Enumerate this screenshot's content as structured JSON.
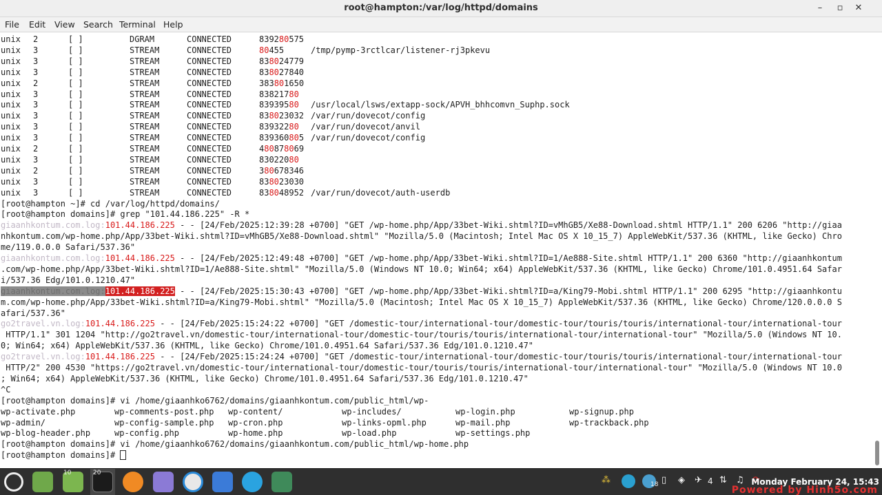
{
  "window": {
    "title": "root@hampton:/var/log/httpd/domains",
    "minimize": "–",
    "maximize": "▫",
    "close": "✕"
  },
  "menu": [
    "File",
    "Edit",
    "View",
    "Search",
    "Terminal",
    "Help"
  ],
  "sockets": [
    {
      "proto": "unix",
      "refcnt": "2",
      "flags": "[ ]",
      "type": "DGRAM",
      "state": "CONNECTED",
      "inode": [
        [
          "8392",
          ""
        ],
        [
          "80",
          "r"
        ],
        [
          "575",
          ""
        ]
      ],
      "path": ""
    },
    {
      "proto": "unix",
      "refcnt": "3",
      "flags": "[ ]",
      "type": "STREAM",
      "state": "CONNECTED",
      "inode": [
        [
          "80",
          "r"
        ],
        [
          "455",
          ""
        ]
      ],
      "path": "/tmp/pymp-3rctlcar/listener-rj3pkevu"
    },
    {
      "proto": "unix",
      "refcnt": "3",
      "flags": "[ ]",
      "type": "STREAM",
      "state": "CONNECTED",
      "inode": [
        [
          "83",
          ""
        ],
        [
          "80",
          "r"
        ],
        [
          "24779",
          ""
        ]
      ],
      "path": ""
    },
    {
      "proto": "unix",
      "refcnt": "3",
      "flags": "[ ]",
      "type": "STREAM",
      "state": "CONNECTED",
      "inode": [
        [
          "83",
          ""
        ],
        [
          "80",
          "r"
        ],
        [
          "27840",
          ""
        ]
      ],
      "path": ""
    },
    {
      "proto": "unix",
      "refcnt": "2",
      "flags": "[ ]",
      "type": "STREAM",
      "state": "CONNECTED",
      "inode": [
        [
          "383",
          ""
        ],
        [
          "80",
          "r"
        ],
        [
          "1650",
          ""
        ]
      ],
      "path": ""
    },
    {
      "proto": "unix",
      "refcnt": "3",
      "flags": "[ ]",
      "type": "STREAM",
      "state": "CONNECTED",
      "inode": [
        [
          "838217",
          ""
        ],
        [
          "80",
          "r"
        ]
      ],
      "path": ""
    },
    {
      "proto": "unix",
      "refcnt": "3",
      "flags": "[ ]",
      "type": "STREAM",
      "state": "CONNECTED",
      "inode": [
        [
          "839395",
          ""
        ],
        [
          "80",
          "r"
        ]
      ],
      "path": "/usr/local/lsws/extapp-sock/APVH_bhhcomvn_Suphp.sock"
    },
    {
      "proto": "unix",
      "refcnt": "3",
      "flags": "[ ]",
      "type": "STREAM",
      "state": "CONNECTED",
      "inode": [
        [
          "83",
          ""
        ],
        [
          "80",
          "r"
        ],
        [
          "23032",
          ""
        ]
      ],
      "path": "/var/run/dovecot/config"
    },
    {
      "proto": "unix",
      "refcnt": "3",
      "flags": "[ ]",
      "type": "STREAM",
      "state": "CONNECTED",
      "inode": [
        [
          "839322",
          ""
        ],
        [
          "80",
          "r"
        ]
      ],
      "path": "/var/run/dovecot/anvil"
    },
    {
      "proto": "unix",
      "refcnt": "3",
      "flags": "[ ]",
      "type": "STREAM",
      "state": "CONNECTED",
      "inode": [
        [
          "839360",
          ""
        ],
        [
          "80",
          "r"
        ],
        [
          "5",
          ""
        ]
      ],
      "path": "/var/run/dovecot/config"
    },
    {
      "proto": "unix",
      "refcnt": "2",
      "flags": "[ ]",
      "type": "STREAM",
      "state": "CONNECTED",
      "inode": [
        [
          "4",
          ""
        ],
        [
          "80",
          "r"
        ],
        [
          "87",
          ""
        ],
        [
          "80",
          "r"
        ],
        [
          "69",
          ""
        ]
      ],
      "path": ""
    },
    {
      "proto": "unix",
      "refcnt": "3",
      "flags": "[ ]",
      "type": "STREAM",
      "state": "CONNECTED",
      "inode": [
        [
          "830220",
          ""
        ],
        [
          "80",
          "r"
        ]
      ],
      "path": ""
    },
    {
      "proto": "unix",
      "refcnt": "2",
      "flags": "[ ]",
      "type": "STREAM",
      "state": "CONNECTED",
      "inode": [
        [
          "3",
          ""
        ],
        [
          "80",
          "r"
        ],
        [
          "678346",
          ""
        ]
      ],
      "path": ""
    },
    {
      "proto": "unix",
      "refcnt": "3",
      "flags": "[ ]",
      "type": "STREAM",
      "state": "CONNECTED",
      "inode": [
        [
          "83",
          ""
        ],
        [
          "80",
          "r"
        ],
        [
          "23030",
          ""
        ]
      ],
      "path": ""
    },
    {
      "proto": "unix",
      "refcnt": "3",
      "flags": "[ ]",
      "type": "STREAM",
      "state": "CONNECTED",
      "inode": [
        [
          "83",
          ""
        ],
        [
          "80",
          "r"
        ],
        [
          "48952",
          ""
        ]
      ],
      "path": "/var/run/dovecot/auth-userdb"
    }
  ],
  "prompt1": "[root@hampton ~]# cd /var/log/httpd/domains/",
  "prompt2": "[root@hampton domains]# grep \"101.44.186.225\" -R *",
  "logs": [
    {
      "host": "giaanhkontum.com.log:",
      "ip": "101.44.186.225",
      "selected": false,
      "lines": [
        " - - [24/Feb/2025:12:39:28 +0700] \"GET /wp-home.php/App/33bet-Wiki.shtml?ID=vMhGB5/Xe88-Download.shtml HTTP/1.1\" 200 6206 \"http://giaa",
        "nhkontum.com/wp-home.php/App/33bet-Wiki.shtml?ID=vMhGB5/Xe88-Download.shtml\" \"Mozilla/5.0 (Macintosh; Intel Mac OS X 10_15_7) AppleWebKit/537.36 (KHTML, like Gecko) Chro",
        "me/119.0.0.0 Safari/537.36\""
      ]
    },
    {
      "host": "giaanhkontum.com.log:",
      "ip": "101.44.186.225",
      "selected": false,
      "lines": [
        " - - [24/Feb/2025:12:49:48 +0700] \"GET /wp-home.php/App/33bet-Wiki.shtml?ID=1/Ae888-Site.shtml HTTP/1.1\" 200 6360 \"http://giaanhkontum",
        ".com/wp-home.php/App/33bet-Wiki.shtml?ID=1/Ae888-Site.shtml\" \"Mozilla/5.0 (Windows NT 10.0; Win64; x64) AppleWebKit/537.36 (KHTML, like Gecko) Chrome/101.0.4951.64 Safar",
        "i/537.36 Edg/101.0.1210.47\""
      ]
    },
    {
      "host": "giaanhkontum.com.log:",
      "ip": "101.44.186.225",
      "selected": true,
      "lines": [
        " - - [24/Feb/2025:15:30:43 +0700] \"GET /wp-home.php/App/33bet-Wiki.shtml?ID=a/King79-Mobi.shtml HTTP/1.1\" 200 6295 \"http://giaanhkontu",
        "m.com/wp-home.php/App/33bet-Wiki.shtml?ID=a/King79-Mobi.shtml\" \"Mozilla/5.0 (Macintosh; Intel Mac OS X 10_15_7) AppleWebKit/537.36 (KHTML, like Gecko) Chrome/120.0.0.0 S",
        "afari/537.36\""
      ]
    },
    {
      "host": "go2travel.vn.log:",
      "ip": "101.44.186.225",
      "selected": false,
      "lines": [
        " - - [24/Feb/2025:15:24:22 +0700] \"GET /domestic-tour/international-tour/domestic-tour/touris/touris/international-tour/international-tour",
        " HTTP/1.1\" 301 1204 \"http://go2travel.vn/domestic-tour/international-tour/domestic-tour/touris/touris/international-tour/international-tour\" \"Mozilla/5.0 (Windows NT 10.",
        "0; Win64; x64) AppleWebKit/537.36 (KHTML, like Gecko) Chrome/101.0.4951.64 Safari/537.36 Edg/101.0.1210.47\""
      ]
    },
    {
      "host": "go2travel.vn.log:",
      "ip": "101.44.186.225",
      "selected": false,
      "lines": [
        " - - [24/Feb/2025:15:24:24 +0700] \"GET /domestic-tour/international-tour/domestic-tour/touris/touris/international-tour/international-tour",
        " HTTP/2\" 200 4530 \"https://go2travel.vn/domestic-tour/international-tour/domestic-tour/touris/touris/international-tour/international-tour\" \"Mozilla/5.0 (Windows NT 10.0",
        "; Win64; x64) AppleWebKit/537.36 (KHTML, like Gecko) Chrome/101.0.4951.64 Safari/537.36 Edg/101.0.1210.47\""
      ]
    }
  ],
  "interrupt": "^C",
  "prompt3": "[root@hampton domains]# vi /home/giaanhko6762/domains/giaanhkontum.com/public_html/wp-",
  "completions": [
    [
      "wp-activate.php",
      "wp-comments-post.php",
      "wp-content/",
      "wp-includes/",
      "wp-login.php",
      "wp-signup.php"
    ],
    [
      "wp-admin/",
      "wp-config-sample.php",
      "wp-cron.php",
      "wp-links-opml.php",
      "wp-mail.php",
      "wp-trackback.php"
    ],
    [
      "wp-blog-header.php",
      "wp-config.php",
      "wp-home.php",
      "wp-load.php",
      "wp-settings.php",
      ""
    ]
  ],
  "prompt4": "[root@hampton domains]# vi /home/giaanhko6762/domains/giaanhkontum.com/public_html/wp-home.php",
  "prompt5": "[root@hampton domains]# ",
  "taskbar": {
    "badges": {
      "files": "10",
      "terminal": "20"
    },
    "tray_count": "4",
    "tray_temp": "18",
    "clock": "Monday February 24, 15:43",
    "watermark": "Powered by Hinh5o.com",
    "icons": [
      "mint-menu-icon",
      "show-desktop-icon",
      "files-icon",
      "terminal-icon",
      "firefox-icon",
      "text-editor-icon",
      "teamviewer-icon",
      "mail-icon",
      "telegram-icon",
      "nqq-icon"
    ]
  },
  "colors": {
    "highlight_red": "#d81818",
    "host_gray": "#c2b8c6",
    "terminal_bg": "#ffffff",
    "taskbar_bg": "#2f2f2f"
  }
}
